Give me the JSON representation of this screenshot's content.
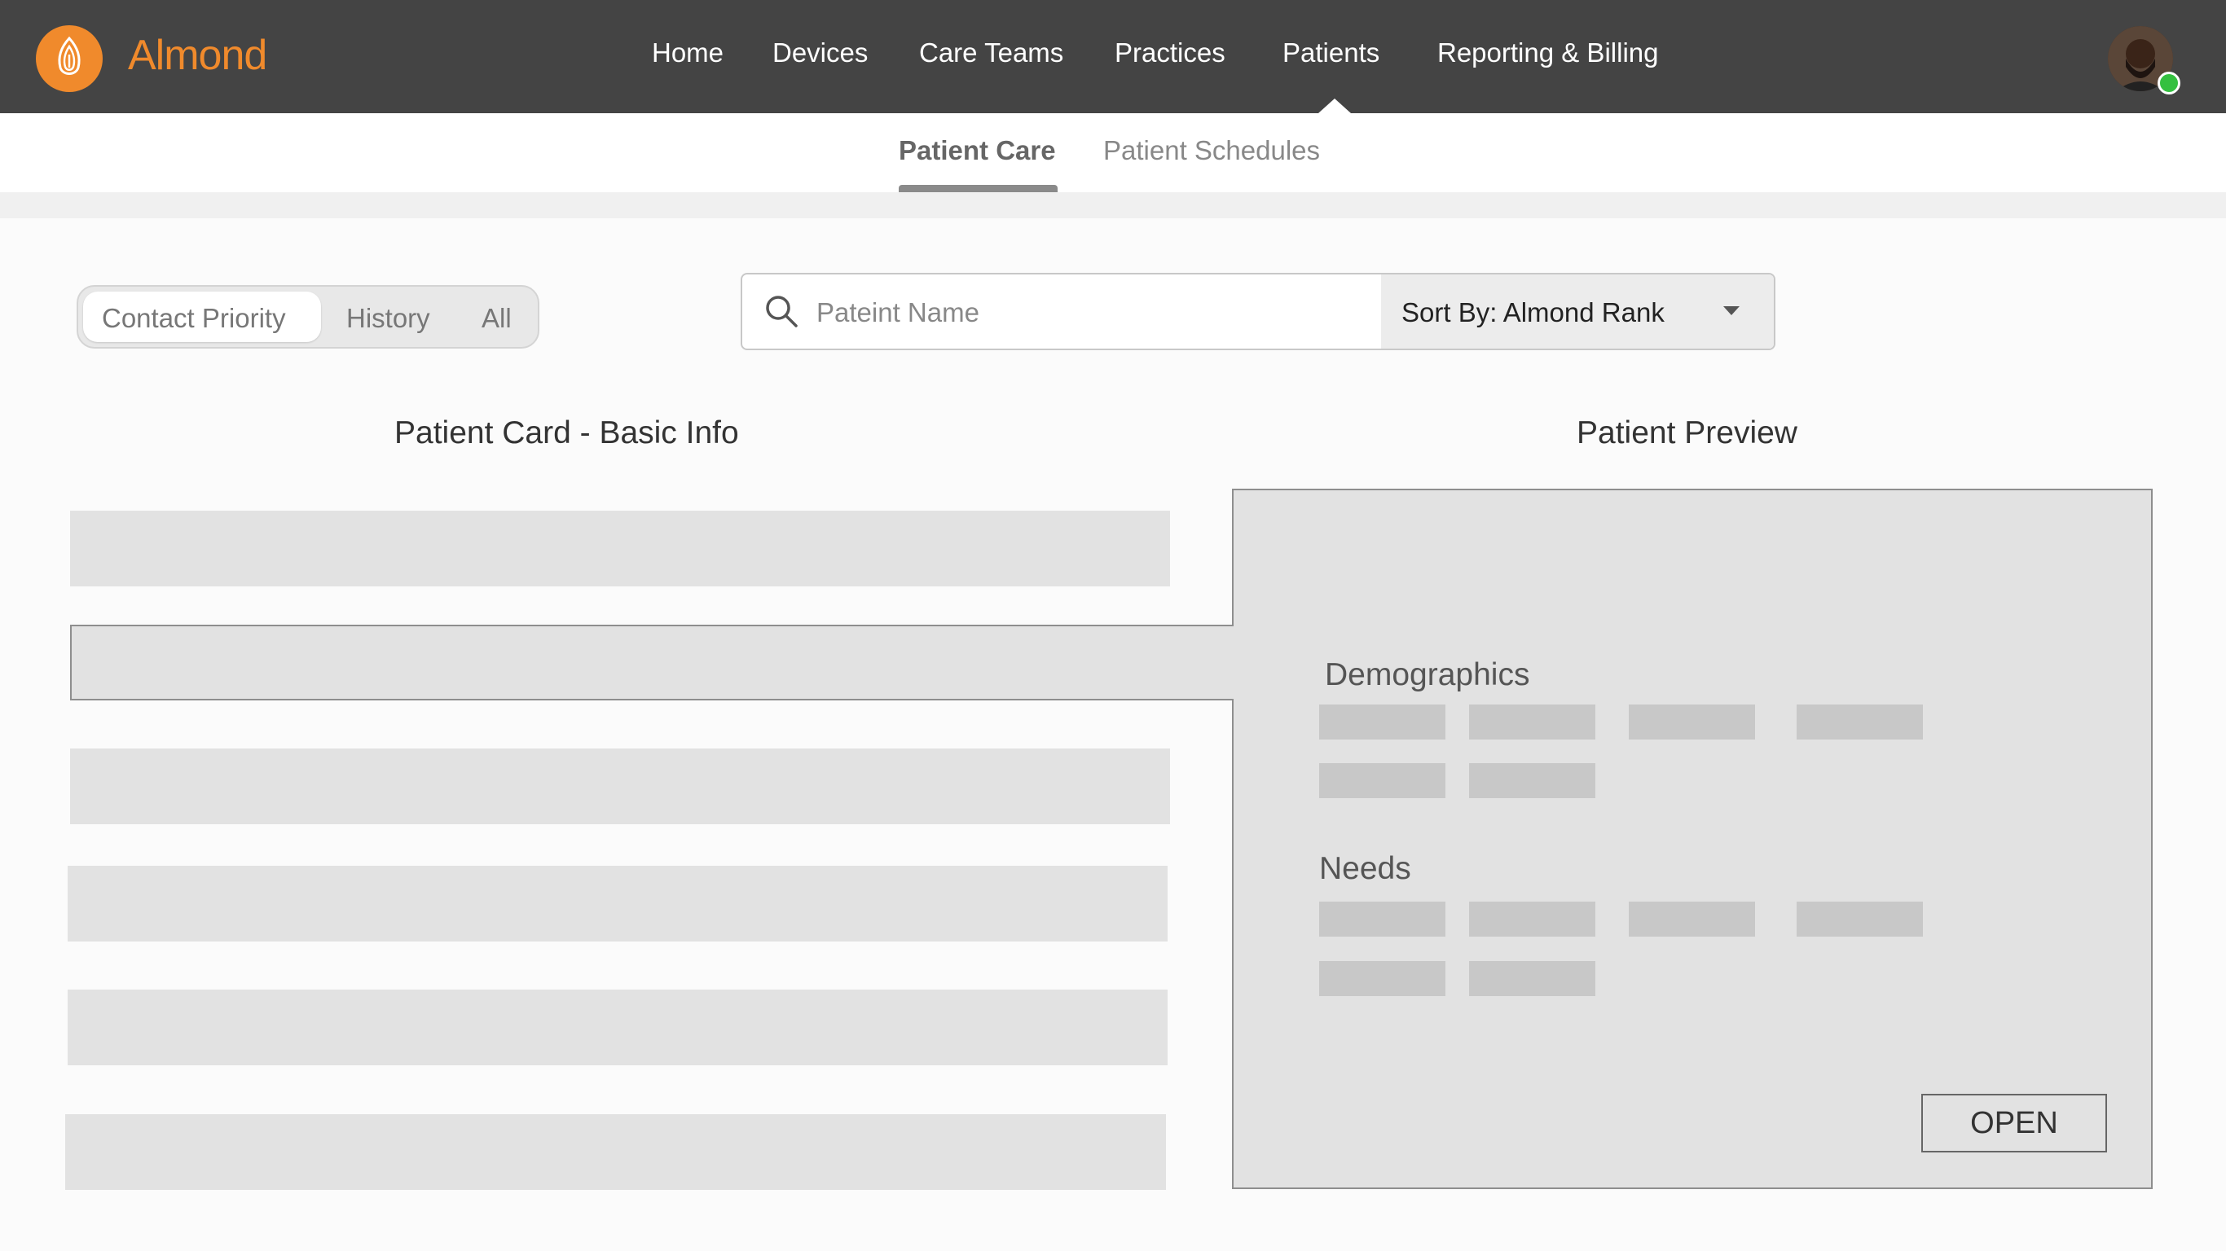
{
  "app": {
    "name": "Almond",
    "brand_color": "#f08a2c",
    "logo_icon": "almond-logo-icon"
  },
  "nav": {
    "items": [
      {
        "label": "Home"
      },
      {
        "label": "Devices"
      },
      {
        "label": "Care Teams"
      },
      {
        "label": "Practices"
      },
      {
        "label": "Patients",
        "active": true
      },
      {
        "label": "Reporting & Billing"
      }
    ]
  },
  "user": {
    "status": "online",
    "status_color": "#34c040"
  },
  "subnav": {
    "tabs": [
      {
        "label": "Patient Care",
        "active": true
      },
      {
        "label": "Patient Schedules"
      }
    ]
  },
  "filter": {
    "options": [
      {
        "label": "Contact Priority",
        "active": true
      },
      {
        "label": "History"
      },
      {
        "label": "All"
      }
    ]
  },
  "search": {
    "placeholder": "Pateint Name",
    "value": ""
  },
  "sort": {
    "label": "Sort By: Almond Rank"
  },
  "list": {
    "heading": "Patient Card - Basic Info",
    "card_count": 6,
    "selected_index": 1
  },
  "preview": {
    "heading": "Patient Preview",
    "demographics_label": "Demographics",
    "needs_label": "Needs",
    "open_label": "OPEN"
  }
}
